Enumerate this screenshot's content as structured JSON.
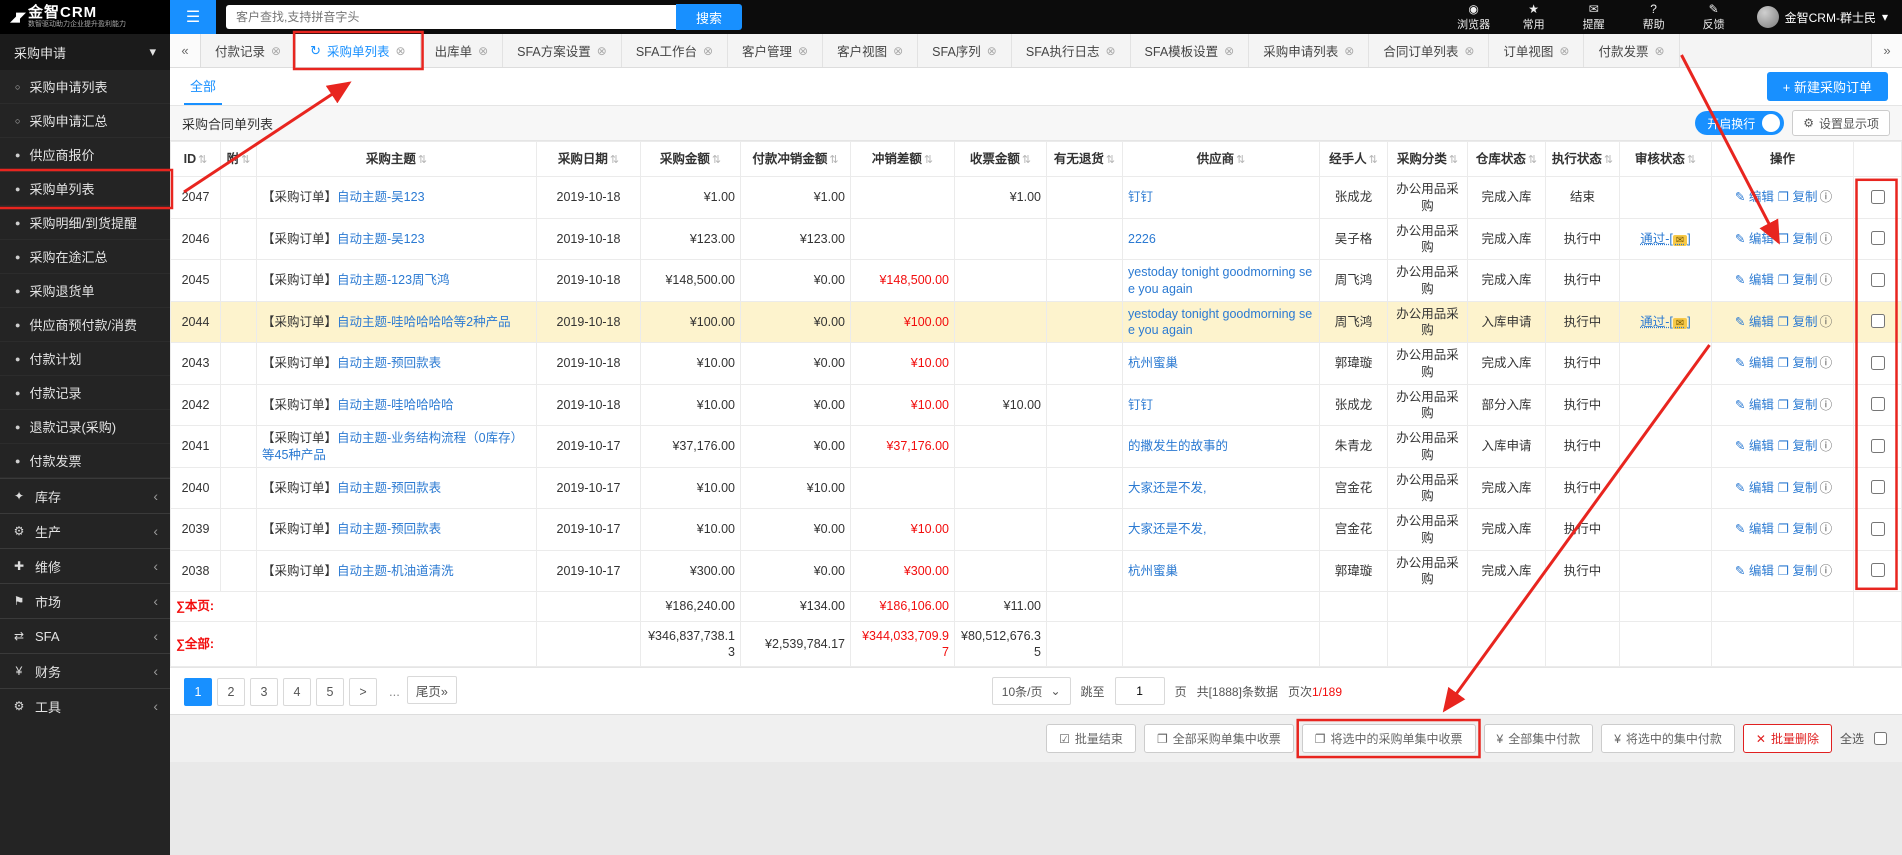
{
  "colors": {
    "accent": "#1890ff",
    "link": "#2b7ad2",
    "danger": "#f20d0d",
    "row_highlight": "#fdf3cd",
    "annotation": "#e8251f"
  },
  "icons": {
    "logo": "◢◤",
    "menu": "☰",
    "browser": "◉",
    "star": "★",
    "bell": "✉",
    "help": "?",
    "feedback": "✎",
    "caret_down": "▾",
    "chevron_down": "▾",
    "chevron_left": "‹",
    "tab_prev": "«",
    "tab_next": "»",
    "close": "⊗",
    "refresh": "↻",
    "sort": "⇅",
    "gear": "⚙",
    "edit": "✎",
    "copy": "❐",
    "info": "ⓘ",
    "seal": "✉",
    "bullet_hollow": "○",
    "bullet_solid": "●",
    "select_caret": "⌄"
  },
  "topbar": {
    "brand": "金智CRM",
    "brand_sub": "数智驱动助力企业提升盈利能力",
    "search_placeholder": "客户查找,支持拼音字头",
    "search_button": "搜索",
    "nav": [
      {
        "id": "browser",
        "label": "浏览器"
      },
      {
        "id": "star",
        "label": "常用"
      },
      {
        "id": "bell",
        "label": "提醒"
      },
      {
        "id": "help",
        "label": "帮助"
      },
      {
        "id": "feedback",
        "label": "反馈"
      }
    ],
    "user": "金智CRM-群士民"
  },
  "sidebar": {
    "parent": {
      "label": "采购申请"
    },
    "items": [
      "采购申请列表",
      "采购申请汇总",
      "供应商报价",
      "采购单列表",
      "采购明细/到货提醒",
      "采购在途汇总",
      "采购退货单",
      "供应商预付款/消费",
      "付款计划",
      "付款记录",
      "退款记录(采购)",
      "付款发票"
    ],
    "sections": [
      {
        "id": "inventory",
        "glyph": "✦",
        "label": "库存"
      },
      {
        "id": "production",
        "glyph": "⚙",
        "label": "生产"
      },
      {
        "id": "repair",
        "glyph": "✚",
        "label": "维修"
      },
      {
        "id": "market",
        "glyph": "⚑",
        "label": "市场"
      },
      {
        "id": "sfa",
        "glyph": "⇄",
        "label": "SFA"
      },
      {
        "id": "finance",
        "glyph": "¥",
        "label": "财务"
      },
      {
        "id": "tools",
        "glyph": "⚙",
        "label": "工具"
      }
    ]
  },
  "tabs": [
    "付款记录",
    "采购单列表",
    "出库单",
    "SFA方案设置",
    "SFA工作台",
    "客户管理",
    "客户视图",
    "SFA序列",
    "SFA执行日志",
    "SFA模板设置",
    "采购申请列表",
    "合同订单列表",
    "订单视图",
    "付款发票"
  ],
  "active_tab": "采购单列表",
  "toolbar": {
    "filter_all": "全部",
    "new_order": "+ 新建采购订单",
    "panel_title": "采购合同单列表",
    "wrap_toggle": "开启换行",
    "display_settings": "设置显示项"
  },
  "table": {
    "columns": [
      "ID",
      "附",
      "采购主题",
      "采购日期",
      "采购金额",
      "付款冲销金额",
      "冲销差额",
      "收票金额",
      "有无退货",
      "供应商",
      "经手人",
      "采购分类",
      "仓库状态",
      "执行状态",
      "审核状态",
      "操作"
    ],
    "theme_prefix": "【采购订单】",
    "ops": {
      "edit": "编辑",
      "copy": "复制"
    },
    "audit_open": "-[",
    "audit_close": "]",
    "rows": [
      {
        "id": "2047",
        "theme": "自动主题-吴123",
        "date": "2019-10-18",
        "amount": "¥1.00",
        "offset": "¥1.00",
        "diff": "",
        "ticket": "¥1.00",
        "supplier": "钉钉",
        "handler": "张成龙",
        "category": "办公用品采购",
        "warehouse": "完成入库",
        "exec": "结束",
        "audit": "",
        "highlight": false
      },
      {
        "id": "2046",
        "theme": "自动主题-吴123",
        "date": "2019-10-18",
        "amount": "¥123.00",
        "offset": "¥123.00",
        "diff": "",
        "ticket": "",
        "supplier": "2226",
        "handler": "吴子格",
        "category": "办公用品采购",
        "warehouse": "完成入库",
        "exec": "执行中",
        "audit": "通过",
        "highlight": false
      },
      {
        "id": "2045",
        "theme": "自动主题-123周飞鸿",
        "date": "2019-10-18",
        "amount": "¥148,500.00",
        "offset": "¥0.00",
        "diff": "¥148,500.00",
        "ticket": "",
        "supplier": "yestoday tonight goodmorning see you again",
        "handler": "周飞鸿",
        "category": "办公用品采购",
        "warehouse": "完成入库",
        "exec": "执行中",
        "audit": "",
        "highlight": false
      },
      {
        "id": "2044",
        "theme": "自动主题-哇哈哈哈哈等2种产品",
        "date": "2019-10-18",
        "amount": "¥100.00",
        "offset": "¥0.00",
        "diff": "¥100.00",
        "ticket": "",
        "supplier": "yestoday tonight goodmorning see you again",
        "handler": "周飞鸿",
        "category": "办公用品采购",
        "warehouse": "入库申请",
        "exec": "执行中",
        "audit": "通过",
        "highlight": true
      },
      {
        "id": "2043",
        "theme": "自动主题-预回款表",
        "date": "2019-10-18",
        "amount": "¥10.00",
        "offset": "¥0.00",
        "diff": "¥10.00",
        "ticket": "",
        "supplier": "杭州蜜巢",
        "handler": "郭瑋璇",
        "category": "办公用品采购",
        "warehouse": "完成入库",
        "exec": "执行中",
        "audit": "",
        "highlight": false
      },
      {
        "id": "2042",
        "theme": "自动主题-哇哈哈哈哈",
        "date": "2019-10-18",
        "amount": "¥10.00",
        "offset": "¥0.00",
        "diff": "¥10.00",
        "ticket": "¥10.00",
        "supplier": "钉钉",
        "handler": "张成龙",
        "category": "办公用品采购",
        "warehouse": "部分入库",
        "exec": "执行中",
        "audit": "",
        "highlight": false
      },
      {
        "id": "2041",
        "theme": "自动主题-业务结构流程（0库存）等45种产品",
        "date": "2019-10-17",
        "amount": "¥37,176.00",
        "offset": "¥0.00",
        "diff": "¥37,176.00",
        "ticket": "",
        "supplier": "的撒发生的故事的",
        "handler": "朱青龙",
        "category": "办公用品采购",
        "warehouse": "入库申请",
        "exec": "执行中",
        "audit": "",
        "highlight": false
      },
      {
        "id": "2040",
        "theme": "自动主题-预回款表",
        "date": "2019-10-17",
        "amount": "¥10.00",
        "offset": "¥10.00",
        "diff": "",
        "ticket": "",
        "supplier": "大家还是不发,",
        "handler": "宫金花",
        "category": "办公用品采购",
        "warehouse": "完成入库",
        "exec": "执行中",
        "audit": "",
        "highlight": false
      },
      {
        "id": "2039",
        "theme": "自动主题-预回款表",
        "date": "2019-10-17",
        "amount": "¥10.00",
        "offset": "¥0.00",
        "diff": "¥10.00",
        "ticket": "",
        "supplier": "大家还是不发,",
        "handler": "宫金花",
        "category": "办公用品采购",
        "warehouse": "完成入库",
        "exec": "执行中",
        "audit": "",
        "highlight": false
      },
      {
        "id": "2038",
        "theme": "自动主题-机油道清洗",
        "date": "2019-10-17",
        "amount": "¥300.00",
        "offset": "¥0.00",
        "diff": "¥300.00",
        "ticket": "",
        "supplier": "杭州蜜巢",
        "handler": "郭瑋璇",
        "category": "办公用品采购",
        "warehouse": "完成入库",
        "exec": "执行中",
        "audit": "",
        "highlight": false
      }
    ],
    "summary_page": {
      "label": "∑本页:",
      "amount": "¥186,240.00",
      "offset": "¥134.00",
      "diff": "¥186,106.00",
      "ticket": "¥11.00"
    },
    "summary_all": {
      "label": "∑全部:",
      "amount": "¥346,837,738.13",
      "offset": "¥2,539,784.17",
      "diff": "¥344,033,709.97",
      "ticket": "¥80,512,676.35"
    }
  },
  "pagination": {
    "pages": [
      {
        "label": "1",
        "active": true
      },
      {
        "label": "2"
      },
      {
        "label": "3"
      },
      {
        "label": "4"
      },
      {
        "label": "5"
      },
      {
        "label": ">"
      },
      {
        "label": "...",
        "ellipsis": true
      },
      {
        "label": "尾页»"
      }
    ],
    "per_page": "10条/页",
    "jump_label": "跳至",
    "jump_value": "1",
    "jump_unit": "页",
    "total": "共[1888]条数据",
    "page_label": "页次",
    "page_value": "1/189"
  },
  "footer": {
    "buttons": [
      {
        "id": "batch-finish",
        "glyph": "☑",
        "label": "批量结束",
        "danger": false
      },
      {
        "id": "collect-all-invoice",
        "glyph": "❐",
        "label": "全部采购单集中收票",
        "danger": false
      },
      {
        "id": "collect-selected-invoice",
        "glyph": "❐",
        "label": "将选中的采购单集中收票",
        "danger": false
      },
      {
        "id": "pay-all",
        "glyph": "¥",
        "label": "全部集中付款",
        "danger": false
      },
      {
        "id": "pay-selected",
        "glyph": "¥",
        "label": "将选中的集中付款",
        "danger": false
      },
      {
        "id": "batch-delete",
        "glyph": "✕",
        "label": "批量删除",
        "danger": true
      }
    ],
    "select_all": "全选"
  },
  "annotations": {
    "sidebar_target": "采购单列表",
    "tab_target": "采购单列表",
    "footer_target": "将选中的采购单集中收票"
  }
}
